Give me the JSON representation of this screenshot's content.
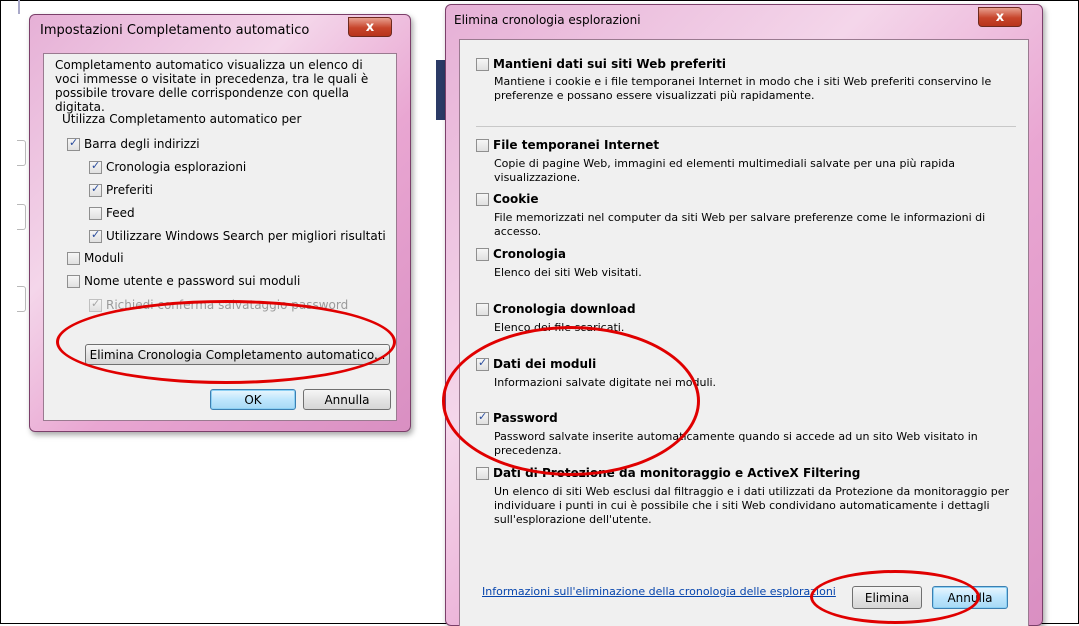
{
  "autocomplete_dialog": {
    "title": "Impostazioni Completamento automatico",
    "description": "Completamento automatico visualizza un elenco di voci immesse o visitate in precedenza, tra le quali è possibile trovare delle corrispondenze con quella digitata.",
    "group_label": "Utilizza Completamento automatico per",
    "options": [
      {
        "label": "Barra degli indirizzi",
        "checked": true
      },
      {
        "label": "Cronologia esplorazioni",
        "checked": true
      },
      {
        "label": "Preferiti",
        "checked": true
      },
      {
        "label": "Feed",
        "checked": false
      },
      {
        "label": "Utilizzare Windows Search per migliori risultati",
        "checked": true
      },
      {
        "label": "Moduli",
        "checked": false
      },
      {
        "label": "Nome utente e password sui moduli",
        "checked": false
      },
      {
        "label": "Richiedi conferma salvataggio password",
        "checked": true,
        "disabled": true
      }
    ],
    "delete_button": "Elimina Cronologia Completamento automatico...",
    "ok_button": "OK",
    "cancel_button": "Annulla"
  },
  "delete_history_dialog": {
    "title": "Elimina cronologia esplorazioni",
    "options": [
      {
        "title": "Mantieni dati sui siti Web preferiti",
        "checked": false,
        "description": "Mantiene i cookie e i file temporanei Internet in modo che i siti Web preferiti conservino le preferenze e possano essere visualizzati più rapidamente."
      },
      {
        "title": "File temporanei Internet",
        "checked": false,
        "description": "Copie di pagine Web, immagini ed elementi multimediali salvate per una più rapida visualizzazione."
      },
      {
        "title": "Cookie",
        "checked": false,
        "description": "File memorizzati nel computer da siti Web per salvare preferenze come le informazioni di accesso."
      },
      {
        "title": "Cronologia",
        "checked": false,
        "description": "Elenco dei siti Web visitati."
      },
      {
        "title": "Cronologia download",
        "checked": false,
        "description": "Elenco dei file scaricati."
      },
      {
        "title": "Dati dei moduli",
        "checked": true,
        "description": "Informazioni salvate digitate nei moduli."
      },
      {
        "title": "Password",
        "checked": true,
        "description": "Password salvate inserite automaticamente quando si accede ad un sito Web visitato in precedenza."
      },
      {
        "title": "Dati di Protezione da monitoraggio e ActiveX Filtering",
        "checked": false,
        "description": "Un elenco di siti Web esclusi dal filtraggio e i dati utilizzati da Protezione da monitoraggio per individuare i punti in cui è possibile che i siti Web condividano automaticamente i dettagli sull'esplorazione dell'utente."
      }
    ],
    "info_link": "Informazioni sull'eliminazione della cronologia delle esplorazioni",
    "delete_button": "Elimina",
    "cancel_button": "Annulla"
  },
  "close_glyph": "x",
  "colors": {
    "annotation_red": "#e00000",
    "aero_pink": "#e9a6d2",
    "close_red": "#c7442b",
    "link_blue": "#0645ad"
  }
}
